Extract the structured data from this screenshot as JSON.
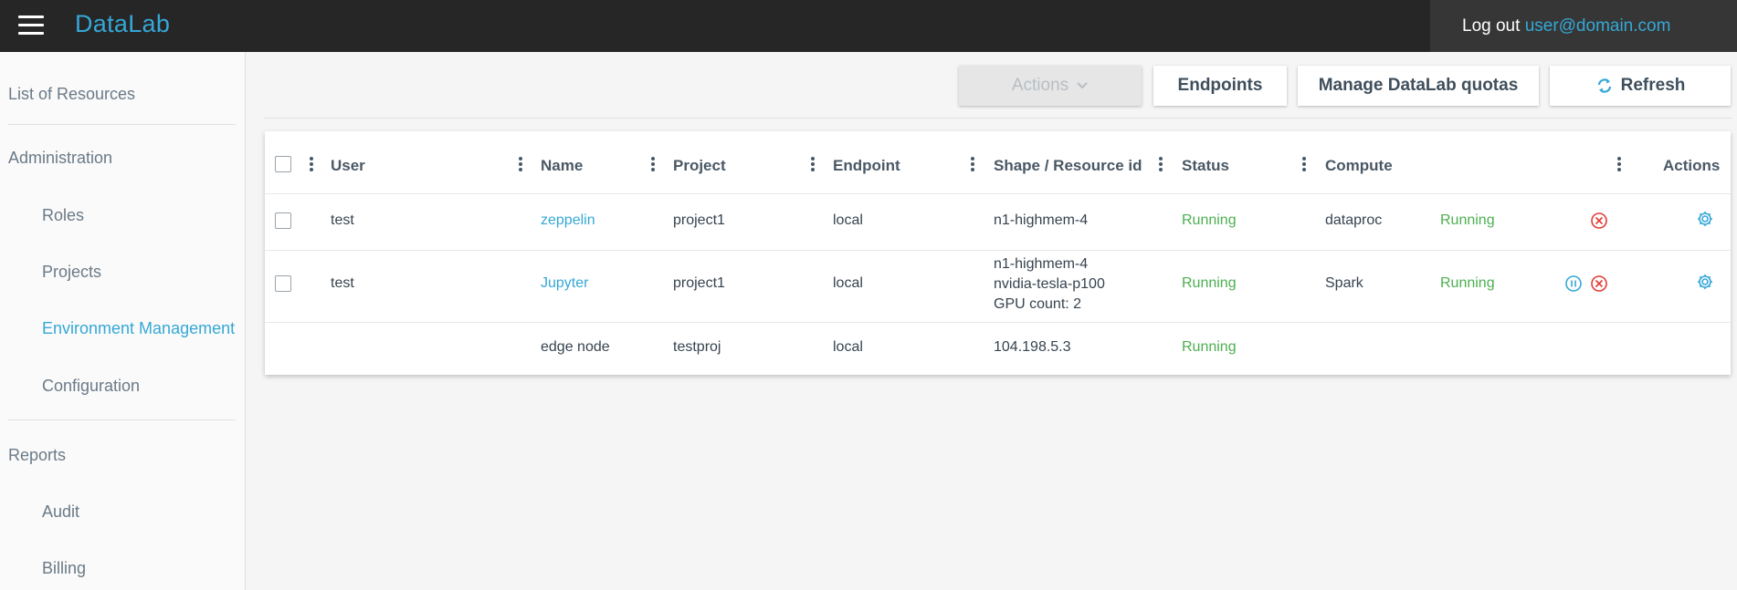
{
  "header": {
    "logo": "DataLab",
    "logout_label": "Log out",
    "user_email": "user@domain.com"
  },
  "sidebar": {
    "list_of_resources": "List of Resources",
    "administration": "Administration",
    "roles": "Roles",
    "projects": "Projects",
    "environment_management": "Environment Management",
    "configuration": "Configuration",
    "reports": "Reports",
    "audit": "Audit",
    "billing": "Billing",
    "active_item": "Environment Management"
  },
  "toolbar": {
    "actions_label": "Actions",
    "endpoints_label": "Endpoints",
    "quotas_label": "Manage DataLab quotas",
    "refresh_label": "Refresh"
  },
  "table": {
    "columns": [
      "User",
      "Name",
      "Project",
      "Endpoint",
      "Shape / Resource id",
      "Status",
      "Compute",
      "Actions"
    ],
    "rows": [
      {
        "user": "test",
        "name": "zeppelin",
        "project": "project1",
        "endpoint": "local",
        "shape": [
          "n1-highmem-4"
        ],
        "status": "Running",
        "compute": "dataproc",
        "compute_status": "Running",
        "controls": [
          "close-circle-icon"
        ],
        "has_checkbox": true
      },
      {
        "user": "test",
        "name": "Jupyter",
        "project": "project1",
        "endpoint": "local",
        "shape": [
          "n1-highmem-4",
          "nvidia-tesla-p100",
          "GPU count: 2"
        ],
        "status": "Running",
        "compute": "Spark",
        "compute_status": "Running",
        "controls": [
          "pause-circle-icon",
          "close-circle-icon"
        ],
        "has_checkbox": true
      },
      {
        "user": "",
        "name": "edge node",
        "project": "testproj",
        "endpoint": "local",
        "shape": [
          "104.198.5.3"
        ],
        "status": "Running",
        "compute": "",
        "compute_status": "",
        "controls": [],
        "has_checkbox": false
      }
    ]
  },
  "colors": {
    "accent": "#35a8d6",
    "running": "#4caf50",
    "danger": "#e53935",
    "header_bg": "#262626"
  }
}
